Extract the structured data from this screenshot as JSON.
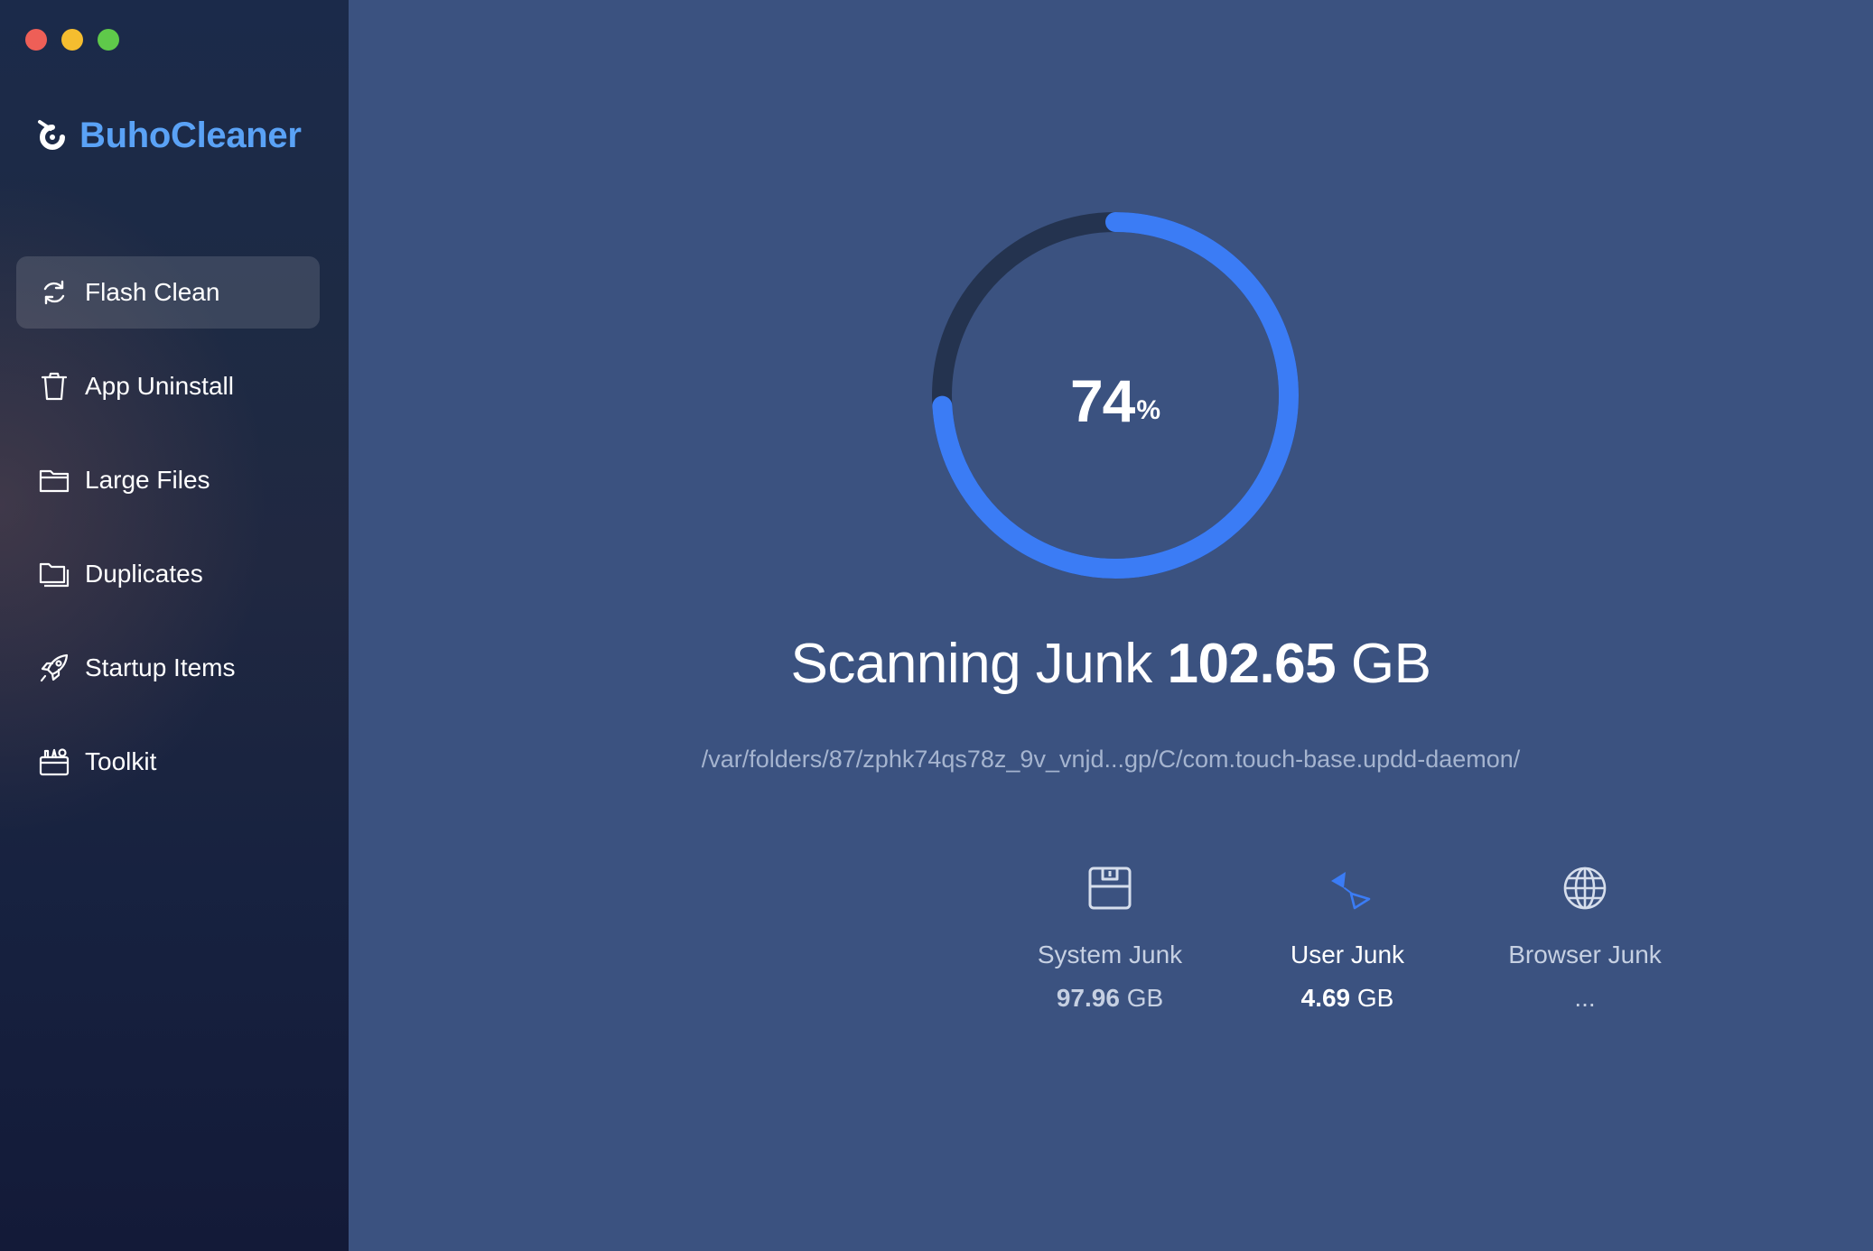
{
  "app": {
    "name": "BuhoCleaner",
    "brand_color": "#5aa2f6"
  },
  "sidebar": {
    "items": [
      {
        "label": "Flash Clean",
        "icon": "refresh-icon",
        "active": true
      },
      {
        "label": "App Uninstall",
        "icon": "trash-icon",
        "active": false
      },
      {
        "label": "Large Files",
        "icon": "folder-icon",
        "active": false
      },
      {
        "label": "Duplicates",
        "icon": "duplicate-folder-icon",
        "active": false
      },
      {
        "label": "Startup Items",
        "icon": "rocket-icon",
        "active": false
      },
      {
        "label": "Toolkit",
        "icon": "toolkit-icon",
        "active": false
      }
    ]
  },
  "scan": {
    "progress_percent": 74,
    "percent_value": "74",
    "percent_unit": "%",
    "title_prefix": "Scanning Junk",
    "total_value": "102.65",
    "total_unit": "GB",
    "current_path": "/var/folders/87/zphk74qs78z_9v_vnjd...gp/C/com.touch-base.updd-daemon/",
    "ring_color": "#3b7cf5",
    "ring_track_color": "#24334f"
  },
  "categories": [
    {
      "name": "System Junk",
      "size_value": "97.96",
      "size_unit": "GB",
      "icon": "disk-icon"
    },
    {
      "name": "User Junk",
      "size_value": "4.69",
      "size_unit": "GB",
      "icon": "spinner-triangles-icon"
    },
    {
      "name": "Browser Junk",
      "size_value": "...",
      "size_unit": "",
      "icon": "globe-icon"
    }
  ]
}
